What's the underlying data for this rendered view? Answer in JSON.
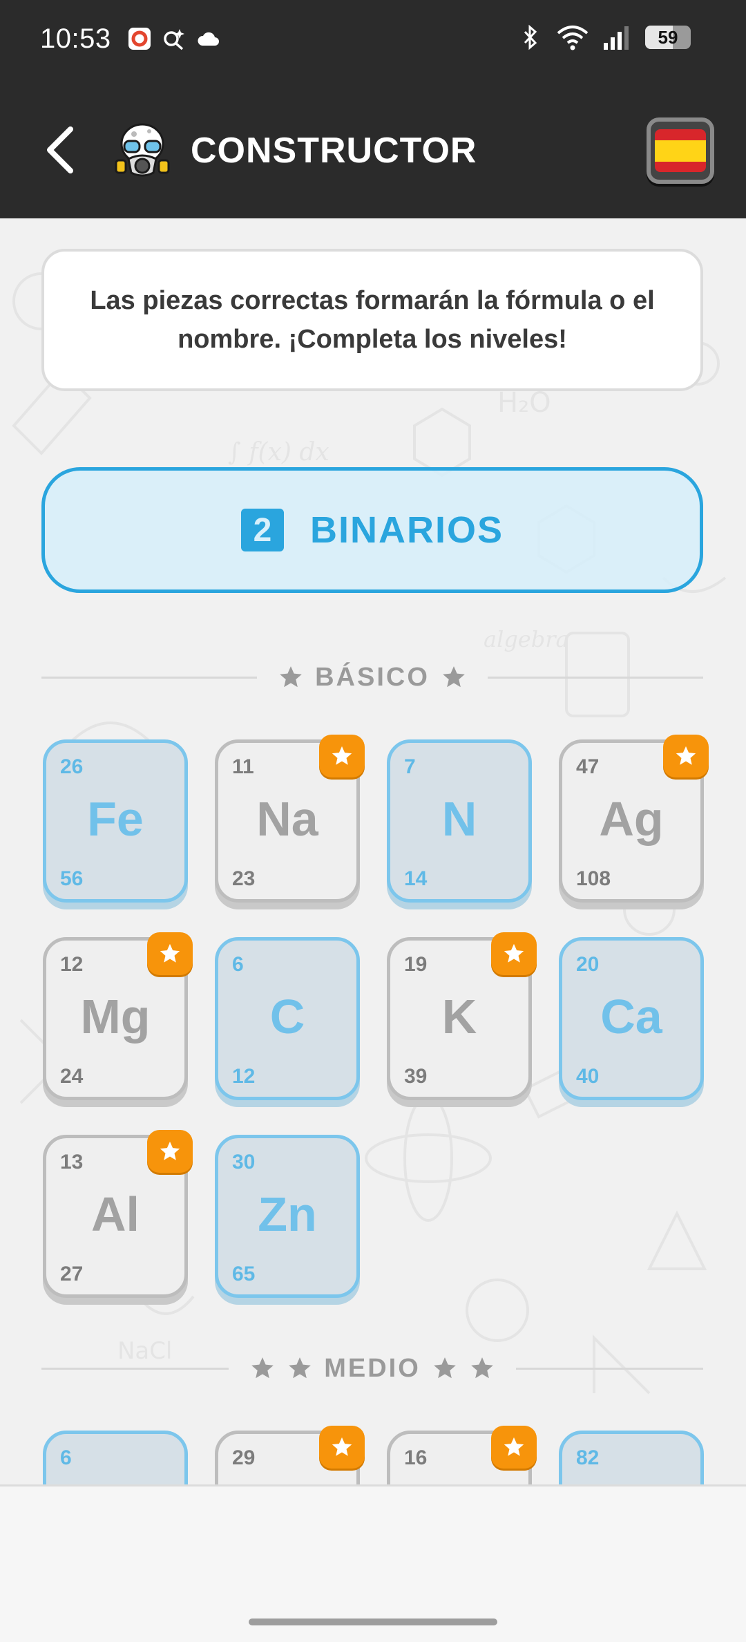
{
  "status_bar": {
    "time": "10:53",
    "battery": "59",
    "left_icons": [
      "app-notification-icon",
      "search-spark-icon",
      "cloud-icon"
    ],
    "right_icons": [
      "bluetooth-icon",
      "wifi-icon",
      "signal-icon",
      "battery-icon"
    ]
  },
  "header": {
    "title": "CONSTRUCTOR",
    "back_icon": "chevron-left-icon",
    "mascot_icon": "gas-mask-mascot-icon",
    "language_flag": "spain-flag-icon"
  },
  "info": {
    "text": "Las piezas correctas formarán la fórmula o el nombre. ¡Completa los niveles!"
  },
  "category": {
    "badge": "2",
    "label": "BINARIOS",
    "accent": "#2aa5de"
  },
  "sections": [
    {
      "label": "BÁSICO",
      "stars": 1,
      "tiles": [
        {
          "number": "26",
          "symbol": "Fe",
          "mass": "56",
          "completed": true,
          "badge": false
        },
        {
          "number": "11",
          "symbol": "Na",
          "mass": "23",
          "completed": false,
          "badge": true
        },
        {
          "number": "7",
          "symbol": "N",
          "mass": "14",
          "completed": true,
          "badge": false
        },
        {
          "number": "47",
          "symbol": "Ag",
          "mass": "108",
          "completed": false,
          "badge": true
        },
        {
          "number": "12",
          "symbol": "Mg",
          "mass": "24",
          "completed": false,
          "badge": true
        },
        {
          "number": "6",
          "symbol": "C",
          "mass": "12",
          "completed": true,
          "badge": false
        },
        {
          "number": "19",
          "symbol": "K",
          "mass": "39",
          "completed": false,
          "badge": true
        },
        {
          "number": "20",
          "symbol": "Ca",
          "mass": "40",
          "completed": true,
          "badge": false
        },
        {
          "number": "13",
          "symbol": "Al",
          "mass": "27",
          "completed": false,
          "badge": true
        },
        {
          "number": "30",
          "symbol": "Zn",
          "mass": "65",
          "completed": true,
          "badge": false
        }
      ]
    },
    {
      "label": "MEDIO",
      "stars": 2,
      "tiles": [
        {
          "number": "6",
          "symbol": "",
          "mass": "",
          "completed": true,
          "badge": false
        },
        {
          "number": "29",
          "symbol": "",
          "mass": "",
          "completed": false,
          "badge": true
        },
        {
          "number": "16",
          "symbol": "",
          "mass": "",
          "completed": false,
          "badge": true
        },
        {
          "number": "82",
          "symbol": "",
          "mass": "",
          "completed": true,
          "badge": false
        }
      ]
    }
  ],
  "colors": {
    "header_bg": "#2b2b2b",
    "completed_border": "#7cc6ec",
    "badge": "#f7940b"
  }
}
